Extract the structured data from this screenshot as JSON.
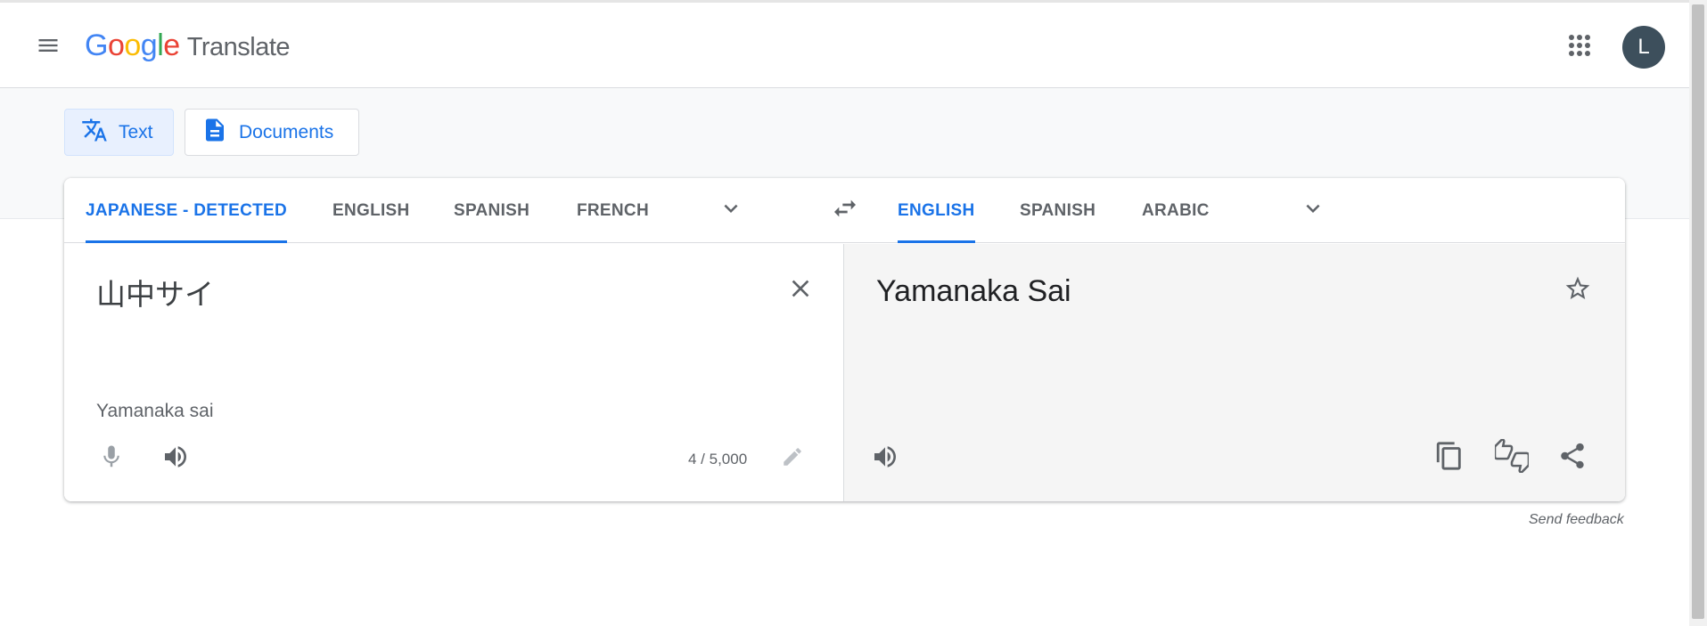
{
  "header": {
    "logo_letters": [
      "G",
      "o",
      "o",
      "g",
      "l",
      "e"
    ],
    "logo_product": "Translate",
    "avatar_initial": "L"
  },
  "modes": [
    {
      "label": "Text",
      "active": true
    },
    {
      "label": "Documents",
      "active": false
    }
  ],
  "source": {
    "tabs": [
      "JAPANESE - DETECTED",
      "ENGLISH",
      "SPANISH",
      "FRENCH"
    ],
    "active_tab": "JAPANESE - DETECTED",
    "text": "山中サイ",
    "romanization": "Yamanaka sai",
    "char_count": "4 / 5,000"
  },
  "target": {
    "tabs": [
      "ENGLISH",
      "SPANISH",
      "ARABIC"
    ],
    "active_tab": "ENGLISH",
    "text": "Yamanaka Sai"
  },
  "footer": {
    "feedback": "Send feedback"
  },
  "colors": {
    "accent": "#1a73e8",
    "avatar": "#3d4f5c",
    "icon": "#5f6368"
  }
}
